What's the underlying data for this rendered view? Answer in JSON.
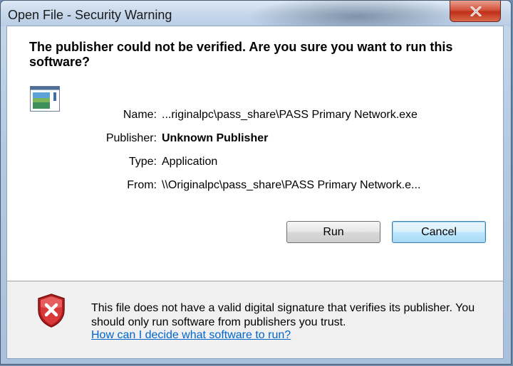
{
  "window": {
    "title": "Open File - Security Warning",
    "close_icon": "close-x-icon"
  },
  "main": {
    "heading": "The publisher could not be verified.  Are you sure you want to run this software?",
    "icon": "application-icon",
    "details": [
      {
        "label": "Name:",
        "value": "...riginalpc\\pass_share\\PASS Primary Network.exe",
        "bold": false
      },
      {
        "label": "Publisher:",
        "value": "Unknown Publisher",
        "bold": true
      },
      {
        "label": "Type:",
        "value": "Application",
        "bold": false
      },
      {
        "label": "From:",
        "value": "\\\\Originalpc\\pass_share\\PASS Primary Network.e...",
        "bold": false
      }
    ],
    "buttons": {
      "run": "Run",
      "cancel": "Cancel"
    }
  },
  "footer": {
    "icon": "security-shield-x-icon",
    "warning_text": "This file does not have a valid digital signature that verifies its publisher.  You should only run software from publishers you trust.",
    "help_link": "How can I decide what software to run?"
  },
  "colors": {
    "link": "#0066cc",
    "shield_red": "#cc2a2a",
    "default_button_border": "#3c7fb1"
  }
}
